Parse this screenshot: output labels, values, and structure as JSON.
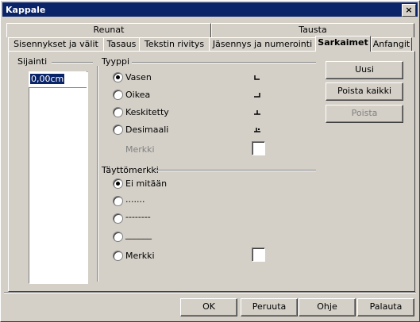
{
  "window": {
    "title": "Kappale",
    "close_glyph": "×"
  },
  "tabs_row1": [
    "Reunat",
    "Tausta"
  ],
  "tabs_row2": [
    "Sisennykset ja välit",
    "Tasaus",
    "Tekstin rivitys",
    "Jäsennys ja numerointi",
    "Sarkaimet",
    "Anfangit"
  ],
  "active_tab": "Sarkaimet",
  "position": {
    "label": "Sijainti",
    "value": "0,00cm"
  },
  "type": {
    "label": "Tyyppi",
    "options": [
      "Vasen",
      "Oikea",
      "Keskitetty",
      "Desimaali"
    ],
    "selected": "Vasen",
    "char_label": "Merkki"
  },
  "fill": {
    "label": "Täyttömerkki",
    "options": [
      "Ei mitään",
      ".......",
      "--------",
      "______",
      "Merkki"
    ],
    "selected": "Ei mitään"
  },
  "side_buttons": {
    "new": "Uusi",
    "delete_all": "Poista kaikki",
    "delete": "Poista"
  },
  "footer": {
    "ok": "OK",
    "cancel": "Peruuta",
    "help": "Ohje",
    "reset": "Palauta"
  }
}
